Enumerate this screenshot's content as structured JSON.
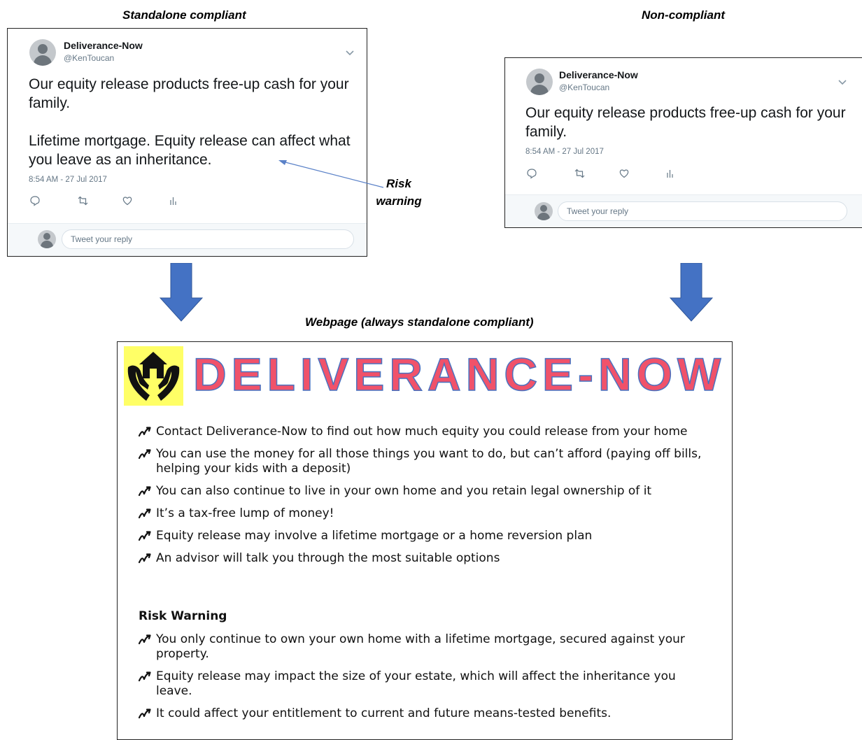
{
  "captions": {
    "standalone": "Standalone compliant",
    "noncompliant": "Non-compliant",
    "webpage": "Webpage (always standalone compliant)"
  },
  "tweet_standalone": {
    "name": "Deliverance-Now",
    "handle": "@KenToucan",
    "text_line1": "Our equity release products free-up cash for your family.",
    "text_line2": "Lifetime mortgage. Equity release can affect what you leave as an inheritance.",
    "timestamp": "8:54 AM - 27 Jul 2017",
    "reply_placeholder": "Tweet your reply"
  },
  "tweet_noncompliant": {
    "name": "Deliverance-Now",
    "handle": "@KenToucan",
    "text_line1": "Our equity release products free-up cash for your family.",
    "timestamp": "8:54 AM - 27 Jul 2017",
    "reply_placeholder": "Tweet your reply"
  },
  "risk_label": {
    "line1": "Risk",
    "line2": "warning"
  },
  "webpage": {
    "brand": "DELIVERANCE-NOW",
    "bullets": [
      "Contact Deliverance-Now to find out how much equity you could release from your home",
      "You can use the money for all those things you want to do, but can’t afford (paying off bills, helping your kids with a deposit)",
      "You can also continue to live in your own home and you retain legal ownership of it",
      "It’s a tax-free lump of money!",
      "Equity release may involve a lifetime mortgage or a home reversion plan",
      "An advisor will talk you through the most suitable options"
    ],
    "risk_heading": "Risk Warning",
    "risk_bullets": [
      "You only continue to own your own home with a lifetime mortgage, secured against your property.",
      "Equity release may impact the size of your estate, which will affect the inheritance you leave.",
      "It could affect your entitlement to current and future means-tested benefits."
    ]
  },
  "colors": {
    "arrow": "#4472c4",
    "brand_fill": "#f0526a",
    "brand_outline": "#4a72c0",
    "logo_bg": "#ffff66",
    "twitter_grey": "#657786"
  },
  "icons": [
    "reply-icon",
    "retweet-icon",
    "like-icon",
    "analytics-icon",
    "chevron-down-icon",
    "house-hands-logo-icon",
    "bullet-arrow-icon"
  ]
}
